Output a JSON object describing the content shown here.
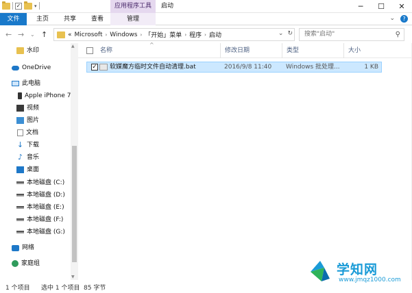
{
  "titlebar": {
    "context_tab_header": "应用程序工具",
    "window_title": "启动",
    "minimize": "─",
    "maximize": "☐",
    "close": "✕"
  },
  "ribbon": {
    "tabs": [
      "文件",
      "主页",
      "共享",
      "查看",
      "管理"
    ],
    "expand": "⌄"
  },
  "address": {
    "back": "←",
    "forward": "→",
    "recent": "⌄",
    "up": "↑",
    "overflow": "«",
    "crumbs": [
      "Microsoft",
      "Windows",
      "「开始」菜单",
      "程序",
      "启动"
    ],
    "dropdown": "⌄",
    "refresh": "↻",
    "search_placeholder": "搜索\"启动\""
  },
  "sidebar": {
    "items": [
      {
        "label": "水印",
        "icon": "folder-icon"
      },
      {
        "label": "OneDrive",
        "icon": "onedrive-icon"
      },
      {
        "label": "此电脑",
        "icon": "computer-icon"
      },
      {
        "label": "Apple iPhone 7",
        "icon": "phone-icon"
      },
      {
        "label": "视频",
        "icon": "video-icon"
      },
      {
        "label": "图片",
        "icon": "pictures-icon"
      },
      {
        "label": "文档",
        "icon": "documents-icon"
      },
      {
        "label": "下载",
        "icon": "download-icon"
      },
      {
        "label": "音乐",
        "icon": "music-icon"
      },
      {
        "label": "桌面",
        "icon": "desktop-icon"
      },
      {
        "label": "本地磁盘 (C:)",
        "icon": "drive-icon"
      },
      {
        "label": "本地磁盘 (D:)",
        "icon": "drive-icon"
      },
      {
        "label": "本地磁盘 (E:)",
        "icon": "drive-icon"
      },
      {
        "label": "本地磁盘 (F:)",
        "icon": "drive-icon"
      },
      {
        "label": "本地磁盘 (G:)",
        "icon": "drive-icon"
      },
      {
        "label": "网络",
        "icon": "network-icon"
      },
      {
        "label": "家庭组",
        "icon": "homegroup-icon"
      }
    ]
  },
  "columns": {
    "name": "名称",
    "modified": "修改日期",
    "type": "类型",
    "size": "大小",
    "sort_indicator": "^"
  },
  "files": [
    {
      "name": "软媒魔方临时文件自动清理.bat",
      "modified": "2016/9/8 11:40",
      "type": "Windows 批处理...",
      "size": "1 KB",
      "checked": "✓"
    }
  ],
  "status": {
    "item_count": "1 个项目",
    "selected": "选中 1 个项目",
    "bytes": "85 字节"
  },
  "watermark": {
    "name": "学知网",
    "url": "www.jmqz1000.com"
  },
  "colors": {
    "accent": "#1979ca",
    "selection": "#cce8ff",
    "context_tab": "#e5d8ef",
    "logo": "#1a9bd7"
  }
}
